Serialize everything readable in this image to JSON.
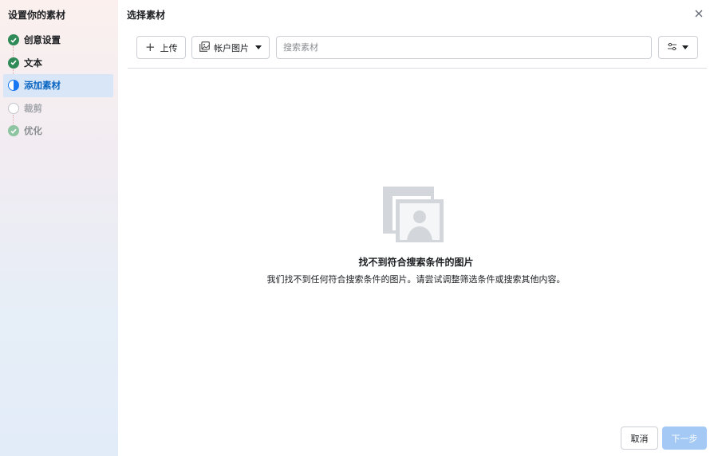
{
  "sidebar": {
    "title": "设置你的素材",
    "steps": [
      {
        "label": "创意设置",
        "state": "done"
      },
      {
        "label": "文本",
        "state": "done"
      },
      {
        "label": "添加素材",
        "state": "current"
      },
      {
        "label": "裁剪",
        "state": "pending"
      },
      {
        "label": "优化",
        "state": "done-faded"
      }
    ]
  },
  "dialog": {
    "title": "选择素材",
    "close_icon": "close-icon"
  },
  "toolbar": {
    "upload_label": "上传",
    "account_images_label": "帐户图片",
    "search_placeholder": "搜索素材",
    "search_value": "",
    "filter_icon": "sliders-icon"
  },
  "empty_state": {
    "icon": "image-placeholder-icon",
    "title": "找不到符合搜索条件的图片",
    "subtitle": "我们找不到任何符合搜索条件的图片。请尝试调整筛选条件或搜索其他内容。"
  },
  "footer": {
    "cancel_label": "取消",
    "next_label": "下一步"
  },
  "colors": {
    "accent": "#1877f2",
    "success": "#2f8a57",
    "next_disabled": "#a4c9f5"
  }
}
